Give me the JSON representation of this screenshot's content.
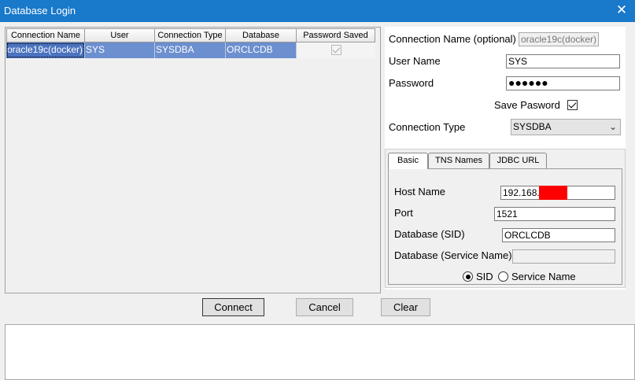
{
  "window": {
    "title": "Database Login",
    "close_label": "✕"
  },
  "connections_table": {
    "columns": [
      "Connection Name",
      "User",
      "Connection Type",
      "Database",
      "Password Saved"
    ],
    "rows": [
      {
        "connection_name": "oracle19c(docker)",
        "user": "SYS",
        "connection_type": "SYSDBA",
        "database": "ORCLCDB",
        "password_saved": true
      }
    ]
  },
  "form": {
    "connection_name_label": "Connection Name (optional)",
    "connection_name_value": "oracle19c(docker)",
    "user_name_label": "User Name",
    "user_name_value": "SYS",
    "password_label": "Password",
    "password_value": "●●●●●●",
    "save_password_label": "Save Pasword",
    "save_password_checked": true,
    "connection_type_label": "Connection Type",
    "connection_type_value": "SYSDBA"
  },
  "tabs": [
    {
      "label": "Basic",
      "active": true
    },
    {
      "label": "TNS Names",
      "active": false
    },
    {
      "label": "JDBC URL",
      "active": false
    }
  ],
  "basic": {
    "host_name_label": "Host Name",
    "host_name_value": "192.168.",
    "port_label": "Port",
    "port_value": "1521",
    "sid_label": "Database (SID)",
    "sid_value": "ORCLCDB",
    "service_name_label": "Database (Service Name)",
    "service_name_value": "",
    "radio_sid_label": "SID",
    "radio_service_label": "Service Name",
    "selected_radio": "SID"
  },
  "buttons": {
    "connect": "Connect",
    "cancel": "Cancel",
    "clear": "Clear"
  },
  "colors": {
    "titlebar": "#1979ca",
    "selection": "#6b8fcf",
    "redaction": "#ff0000"
  }
}
